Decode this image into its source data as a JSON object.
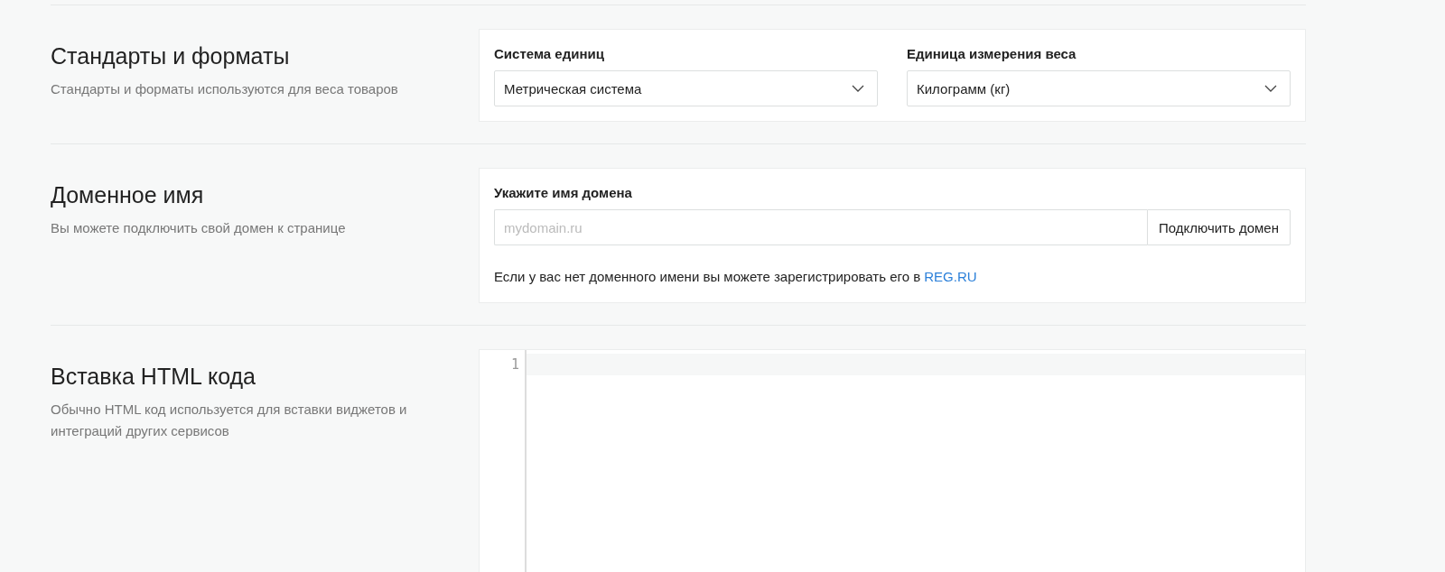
{
  "sections": [
    {
      "kind": "selects",
      "title": "Стандарты и форматы",
      "description": "Стандарты и форматы используются для веса товаров",
      "selects": [
        {
          "label": "Система единиц",
          "value": "Метрическая система"
        },
        {
          "label": "Единица измерения веса",
          "value": "Килограмм (кг)"
        }
      ]
    },
    {
      "kind": "domain",
      "title": "Доменное имя",
      "description": "Вы можете подключить свой домен к странице",
      "label": "Укажите имя домена",
      "placeholder": "mydomain.ru",
      "button": "Подключить домен",
      "note": "Если у вас нет доменного имени вы можете зарегистрировать его в",
      "link": "REG.RU"
    },
    {
      "kind": "code",
      "title": "Вставка HTML кода",
      "description": "Обычно HTML код используется для вставки виджетов и интеграций других сервисов",
      "line_numbers": [
        "1"
      ]
    }
  ]
}
